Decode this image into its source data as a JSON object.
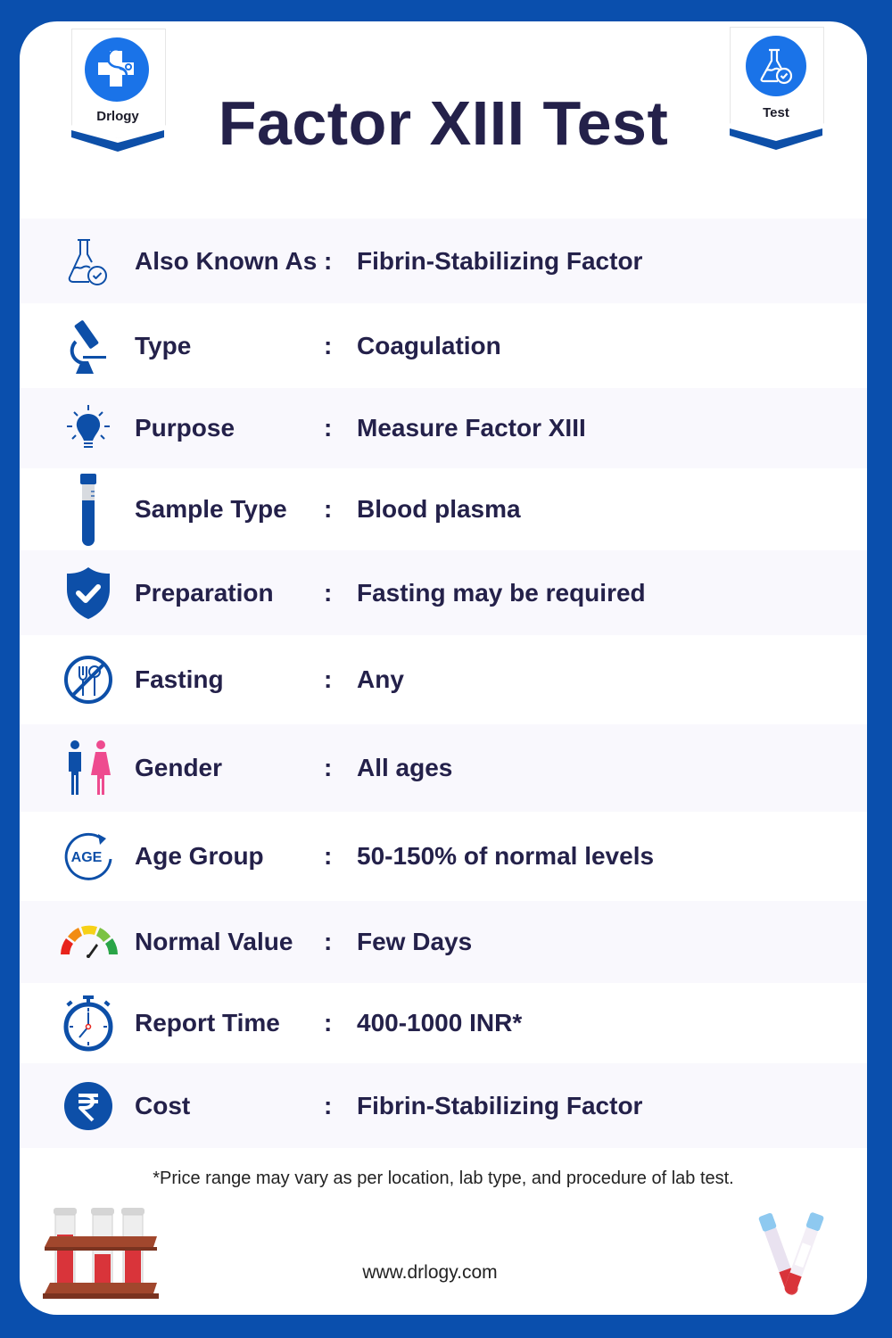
{
  "header": {
    "title": "Factor XIII Test",
    "left_badge": {
      "label": "Drlogy",
      "icon": "doctor-cross-stethoscope-icon"
    },
    "right_badge": {
      "label": "Test",
      "icon": "flask-check-icon"
    }
  },
  "rows": [
    {
      "icon": "flask-check-icon",
      "label": "Also Known As",
      "colon": ":",
      "value": "Fibrin-Stabilizing Factor"
    },
    {
      "icon": "microscope-icon",
      "label": "Type",
      "colon": ":",
      "value": "Coagulation"
    },
    {
      "icon": "lightbulb-icon",
      "label": "Purpose",
      "colon": ":",
      "value": "Measure Factor XIII"
    },
    {
      "icon": "test-tube-icon",
      "label": "Sample Type",
      "colon": ":",
      "value": "Blood plasma"
    },
    {
      "icon": "shield-check-icon",
      "label": "Preparation",
      "colon": ":",
      "value": "Fasting may be required"
    },
    {
      "icon": "no-food-icon",
      "label": "Fasting",
      "colon": ":",
      "value": "Any"
    },
    {
      "icon": "male-female-icon",
      "label": "Gender",
      "colon": ":",
      "value": "All ages"
    },
    {
      "icon": "age-cycle-icon",
      "label": "Age Group",
      "colon": ":",
      "value": "50-150% of normal levels"
    },
    {
      "icon": "gauge-meter-icon",
      "label": "Normal Value",
      "colon": ":",
      "value": "Few Days"
    },
    {
      "icon": "stopwatch-icon",
      "label": "Report Time",
      "colon": ":",
      "value": "400-1000 INR*"
    },
    {
      "icon": "rupee-icon",
      "label": "Cost",
      "colon": ":",
      "value": "Fibrin-Stabilizing Factor"
    }
  ],
  "footer": {
    "note": "*Price range may vary as per location, lab type, and procedure of lab test.",
    "website": "www.drlogy.com"
  },
  "colors": {
    "frame": "#0a4fad",
    "icon_blue": "#0d4fa8",
    "badge_blue": "#1a73e8",
    "text_dark": "#24214a",
    "row_shade": "#f9f8fd"
  }
}
